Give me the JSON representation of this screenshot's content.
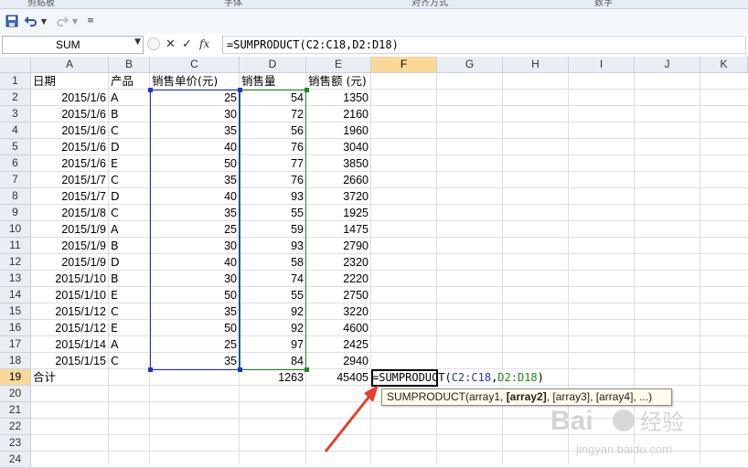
{
  "ribbon": {
    "groups": [
      "剪贴板",
      "字体",
      "对齐方式",
      "数字"
    ]
  },
  "name_box": {
    "value": "SUM"
  },
  "formula_bar": {
    "value": "=SUMPRODUCT(C2:C18,D2:D18)"
  },
  "columns": [
    "A",
    "B",
    "C",
    "D",
    "E",
    "F",
    "G",
    "H",
    "I",
    "J",
    "K"
  ],
  "rows": [
    "1",
    "2",
    "3",
    "4",
    "5",
    "6",
    "7",
    "8",
    "9",
    "10",
    "11",
    "12",
    "13",
    "14",
    "15",
    "16",
    "17",
    "18",
    "19",
    "20",
    "21",
    "22",
    "23",
    "24"
  ],
  "headers": {
    "a": "日期",
    "b": "产品",
    "c": "销售单价(元)",
    "d": "销售量",
    "e": "销售额 (元)"
  },
  "records": [
    {
      "date": "2015/1/6",
      "product": "A",
      "price": "25",
      "qty": "54",
      "amount": "1350"
    },
    {
      "date": "2015/1/6",
      "product": "B",
      "price": "30",
      "qty": "72",
      "amount": "2160"
    },
    {
      "date": "2015/1/6",
      "product": "C",
      "price": "35",
      "qty": "56",
      "amount": "1960"
    },
    {
      "date": "2015/1/6",
      "product": "D",
      "price": "40",
      "qty": "76",
      "amount": "3040"
    },
    {
      "date": "2015/1/6",
      "product": "E",
      "price": "50",
      "qty": "77",
      "amount": "3850"
    },
    {
      "date": "2015/1/7",
      "product": "C",
      "price": "35",
      "qty": "76",
      "amount": "2660"
    },
    {
      "date": "2015/1/7",
      "product": "D",
      "price": "40",
      "qty": "93",
      "amount": "3720"
    },
    {
      "date": "2015/1/8",
      "product": "C",
      "price": "35",
      "qty": "55",
      "amount": "1925"
    },
    {
      "date": "2015/1/9",
      "product": "A",
      "price": "25",
      "qty": "59",
      "amount": "1475"
    },
    {
      "date": "2015/1/9",
      "product": "B",
      "price": "30",
      "qty": "93",
      "amount": "2790"
    },
    {
      "date": "2015/1/9",
      "product": "D",
      "price": "40",
      "qty": "58",
      "amount": "2320"
    },
    {
      "date": "2015/1/10",
      "product": "B",
      "price": "30",
      "qty": "74",
      "amount": "2220"
    },
    {
      "date": "2015/1/10",
      "product": "E",
      "price": "50",
      "qty": "55",
      "amount": "2750"
    },
    {
      "date": "2015/1/12",
      "product": "C",
      "price": "35",
      "qty": "92",
      "amount": "3220"
    },
    {
      "date": "2015/1/12",
      "product": "E",
      "price": "50",
      "qty": "92",
      "amount": "4600"
    },
    {
      "date": "2015/1/14",
      "product": "A",
      "price": "25",
      "qty": "97",
      "amount": "2425"
    },
    {
      "date": "2015/1/15",
      "product": "C",
      "price": "35",
      "qty": "84",
      "amount": "2940"
    }
  ],
  "totals": {
    "label": "合计",
    "qty": "1263",
    "amount": "45405"
  },
  "active_cell": {
    "prefix": "=SUMPRODUCT(",
    "range1": "C2:C18",
    "sep": ",",
    "range2": "D2:D18",
    "suffix": ")"
  },
  "tooltip": {
    "fn": "SUMPRODUCT(",
    "arg1": "array1, ",
    "arg2": "[array2]",
    "rest": ", [array3], [array4], ...)"
  },
  "colors": {
    "range1": "#1f33c9",
    "range2": "#1c8a1c",
    "selected_header": "#f9d99a",
    "arrow": "#e5402c"
  },
  "watermark": {
    "brand": "Bai",
    "brand2": "经验",
    "url": "jingyan.baidu.com"
  },
  "icons": [
    "save-icon",
    "undo-icon",
    "redo-icon",
    "customize-icon",
    "cancel-icon",
    "enter-icon",
    "insert-function-icon"
  ]
}
